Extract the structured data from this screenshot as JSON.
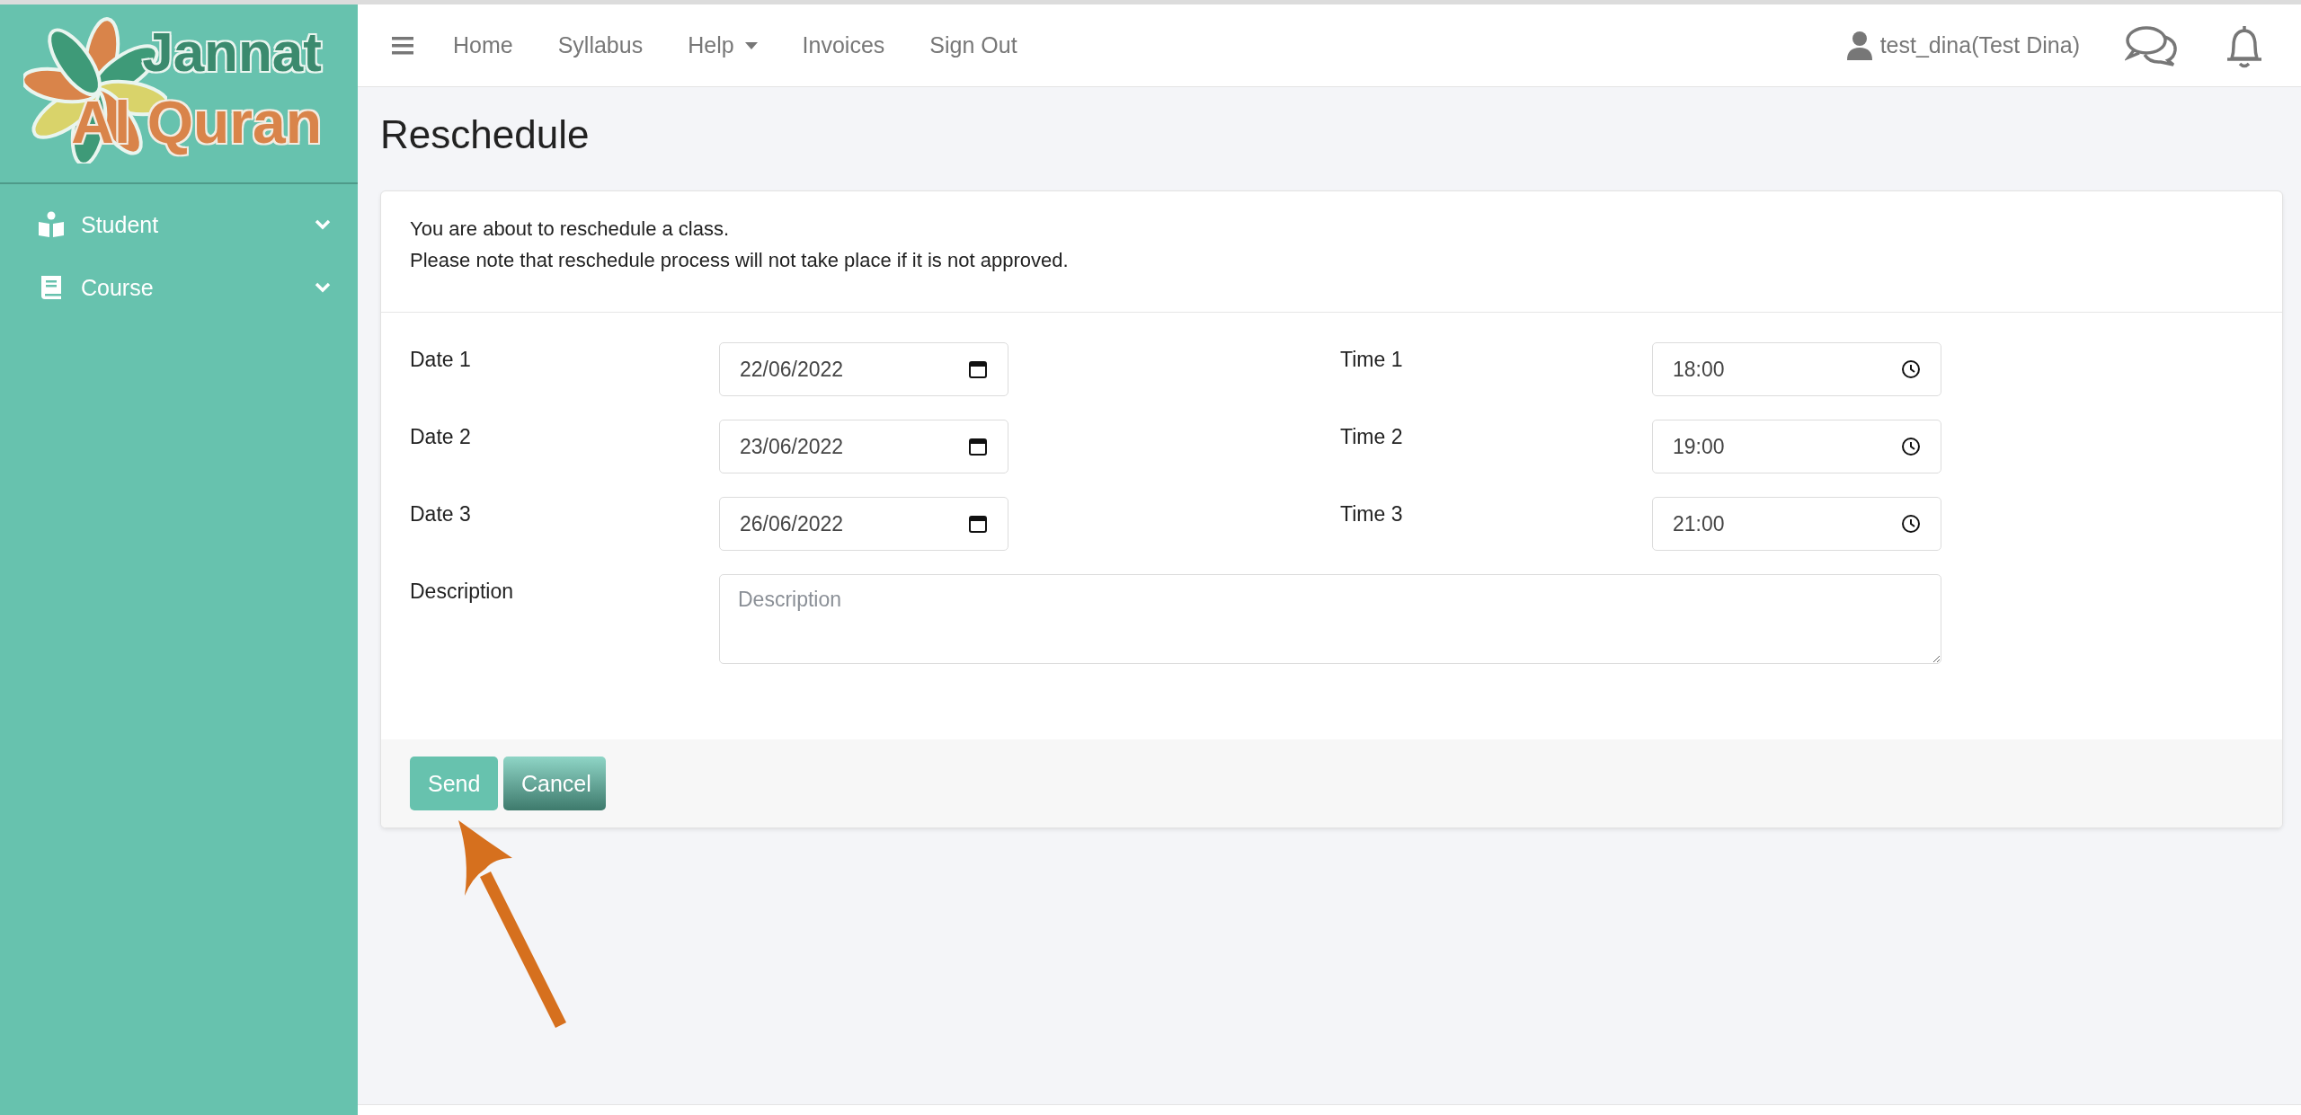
{
  "logo": {
    "line_1": "Jannat",
    "line_2": "Al Quran"
  },
  "sidebar": {
    "items": [
      {
        "label": "Student",
        "has_submenu": true
      },
      {
        "label": "Course",
        "has_submenu": true
      }
    ]
  },
  "topbar": {
    "nav_items": [
      {
        "label": "Home",
        "dropdown": false
      },
      {
        "label": "Syllabus",
        "dropdown": false
      },
      {
        "label": "Help",
        "dropdown": true
      },
      {
        "label": "Invoices",
        "dropdown": false
      },
      {
        "label": "Sign Out",
        "dropdown": false
      }
    ],
    "user": "test_dina(Test Dina)"
  },
  "page_title": "Reschedule",
  "card": {
    "notice_lines": [
      "You are about to reschedule a class.",
      "Please note that reschedule process will not take place if it is not approved."
    ],
    "rows": [
      {
        "date_label": "Date 1",
        "date": "22/06/2022",
        "time_label": "Time 1",
        "time": "18:00"
      },
      {
        "date_label": "Date 2",
        "date": "23/06/2022",
        "time_label": "Time 2",
        "time": "19:00"
      },
      {
        "date_label": "Date 3",
        "date": "26/06/2022",
        "time_label": "Time 3",
        "time": "21:00"
      }
    ],
    "description": {
      "label": "Description",
      "placeholder": "Description"
    },
    "buttons": [
      {
        "label": "Send",
        "kind": "primary"
      },
      {
        "label": "Cancel",
        "kind": "secondary"
      }
    ]
  }
}
